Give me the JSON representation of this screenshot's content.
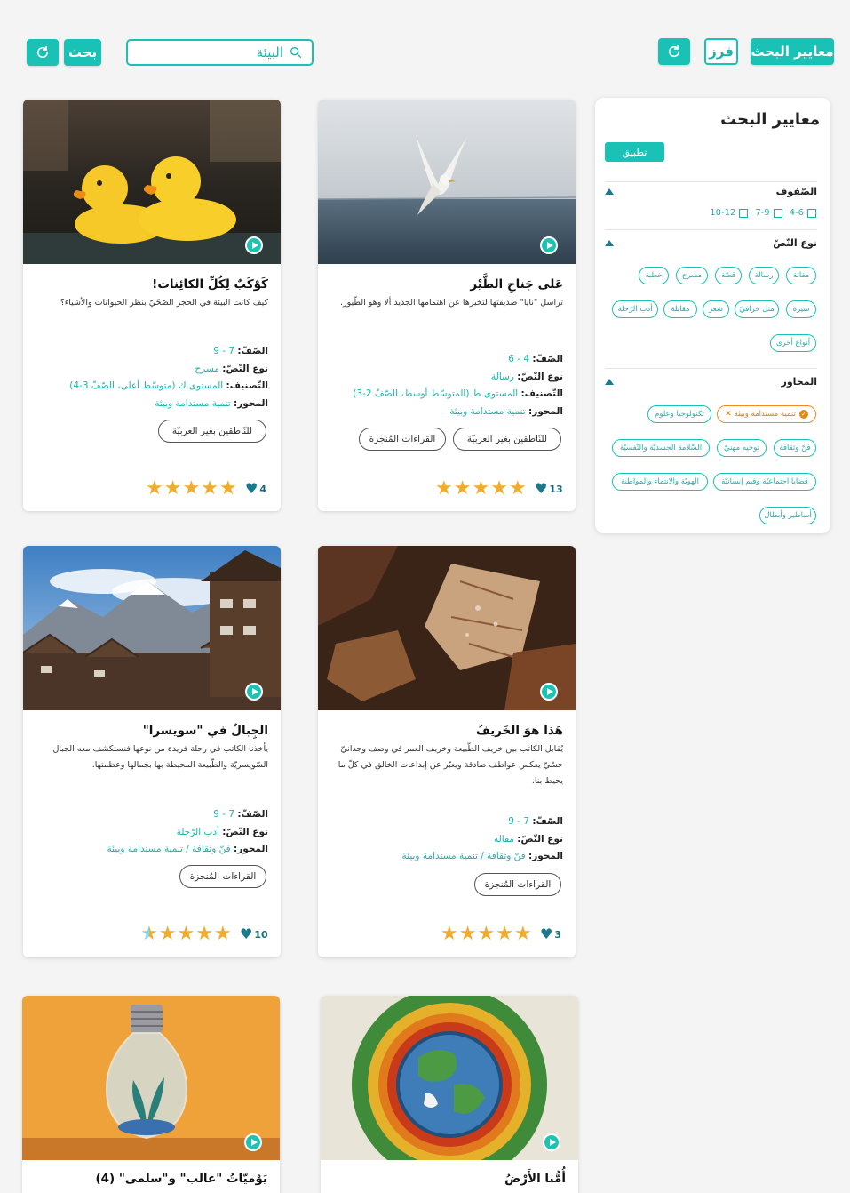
{
  "toolbar": {
    "criteria_button": "معايير البحث",
    "sort_button": "فرز",
    "search_button": "بحث",
    "search_value": "البيئة"
  },
  "sidebar": {
    "title": "معايير البحث",
    "apply": "تطبيق",
    "grades_label": "الصّفوف",
    "grades": [
      "4-6",
      "7-9",
      "10-12"
    ],
    "text_type_label": "نوع النّصّ",
    "text_types": [
      "مقالة",
      "رسالة",
      "قصّة",
      "مسرح",
      "خطبة",
      "سيرة",
      "مثل خرافيّ",
      "شعر",
      "مقابلة",
      "أدب الرّحلة",
      "أنواع أخرى"
    ],
    "axes_label": "المحاور",
    "axes_active": "تنمية مستدامة وبيئة",
    "axes": [
      "تكنولوجيا وعلوم",
      "فنّ وثقافة",
      "توجيه مهنيّ",
      "السّلامة الجسديّة والنّفسيّة",
      "قضايا اجتماعيّة وقيم إنسانيّة",
      "الهويّة والانتماء والمواطنة",
      "أساطير وأبطال"
    ]
  },
  "labels": {
    "grade": "الصّفّ:",
    "type": "نوع النّصّ:",
    "class": "التّصنيف:",
    "axis": "المحور:"
  },
  "cards": [
    {
      "title": "عَلى جَناحِ الطَّيْر",
      "desc": "تراسل \"نايا\" صديقتها لتخبرها عن اهتمامها الجديد ألا وهو الطّيور.",
      "grade": "4 - 6",
      "type": "رسالة",
      "class": "المستوى ط (المتوسّط أوسط، الصّفّ 2-3)",
      "axis": "تنمية مستدامة وبيئة",
      "btn1": "للنّاطقين بغير العربيّة",
      "btn2": "القراءات المُنجزة",
      "likes": "13",
      "rating": 5
    },
    {
      "title": "كَوْكَبٌ لِكُلِّ الكائِنات!",
      "desc": "كيف كانت البيئة في الحجر الصّحّيّ بنظر الحيوانات والأشياء؟",
      "grade": "7 - 9",
      "type": "مسرح",
      "class": "المستوى ك (متوسّط أعلى، الصّفّ 3-4)",
      "axis": "تنمية مستدامة وبيئة",
      "btn1": "للنّاطقين بغير العربيّة",
      "likes": "4",
      "rating": 5
    },
    {
      "title": "هَذا هوَ الخَريفُ",
      "desc": "يُقابل الكاتب بين خريف الطّبيعة وخريف العمر في وصف وجدانيّ حسّيّ يعكس عواطف صادقة ويعبّر عن إبداعات الخالق في كلّ ما يحيط بنا.",
      "grade": "7 - 9",
      "type": "مقالة",
      "axis": "فنّ وثقافة / تنمية مستدامة وبيئة",
      "btn1": "القراءات المُنجزة",
      "likes": "3",
      "rating": 5
    },
    {
      "title": "الجِبالُ في \"سويسرا\"",
      "desc": "يأخذنا الكاتب في رحلة فريدة من نوعها فنستكشف معه الجبال السّويسريّة والطّبيعة المحيطة بها بجمالها وعظمتها.",
      "grade": "7 - 9",
      "type": "أدب الرّحلة",
      "axis": "فنّ وثقافة / تنمية مستدامة وبيئة",
      "btn1": "القراءات المُنجزة",
      "likes": "10",
      "rating": 4.5
    },
    {
      "title": "أُمُّنا الأَرْضُ"
    },
    {
      "title": "يَوْميّاتُ \"غالب\" و\"سلمى\" (4)"
    }
  ],
  "colors": {
    "accent": "#19c2b4",
    "star": "#f1ac2b",
    "heart": "#1a7a8c",
    "active_chip": "#f08a24"
  }
}
